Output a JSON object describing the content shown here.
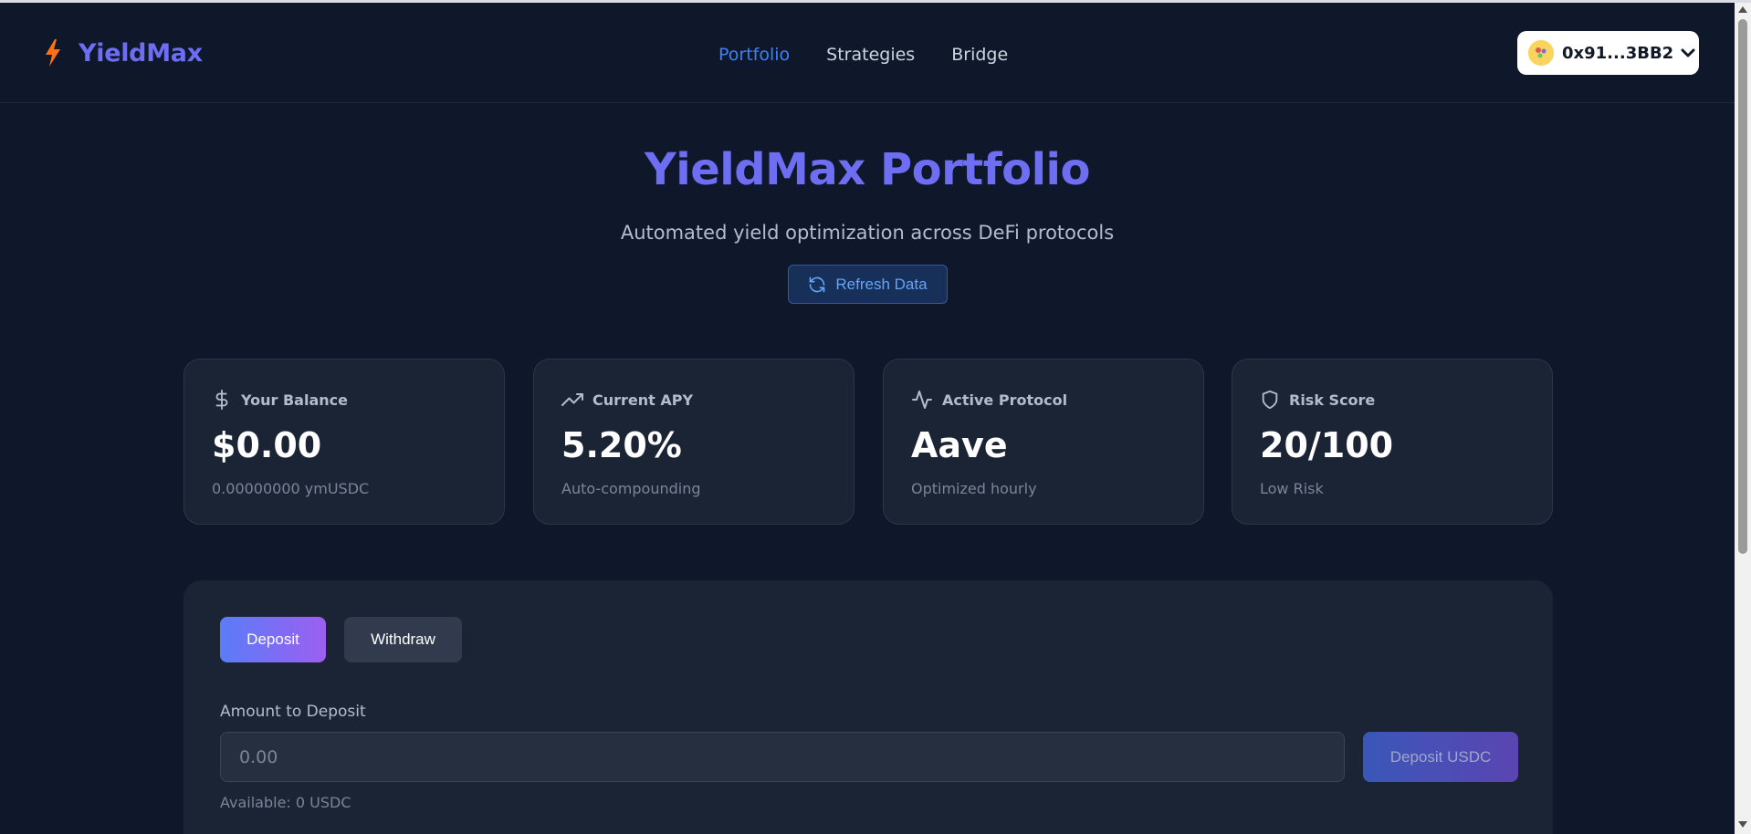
{
  "app": {
    "name": "YieldMax",
    "logo_icon": "lightning-bolt-icon",
    "accent_color": "#6d6ef2"
  },
  "nav": {
    "items": [
      {
        "label": "Portfolio",
        "active": true
      },
      {
        "label": "Strategies",
        "active": false
      },
      {
        "label": "Bridge",
        "active": false
      }
    ]
  },
  "wallet": {
    "address": "0x91...3BB2",
    "avatar_icon": "wallet-avatar-icon",
    "chevron_icon": "chevron-down-icon"
  },
  "hero": {
    "title": "YieldMax Portfolio",
    "subtitle": "Automated yield optimization across DeFi protocols",
    "refresh_label": "Refresh Data",
    "refresh_icon": "refresh-icon"
  },
  "stats": [
    {
      "icon": "dollar-icon",
      "label": "Your Balance",
      "value": "$0.00",
      "sub": "0.00000000 ymUSDC"
    },
    {
      "icon": "trending-up-icon",
      "label": "Current APY",
      "value": "5.20%",
      "sub": "Auto-compounding"
    },
    {
      "icon": "activity-icon",
      "label": "Active Protocol",
      "value": "Aave",
      "sub": "Optimized hourly"
    },
    {
      "icon": "shield-icon",
      "label": "Risk Score",
      "value": "20/100",
      "sub": "Low Risk"
    }
  ],
  "action_panel": {
    "tabs": [
      {
        "label": "Deposit",
        "active": true
      },
      {
        "label": "Withdraw",
        "active": false
      }
    ],
    "amount_label": "Amount to Deposit",
    "amount_placeholder": "0.00",
    "amount_value": "",
    "submit_label": "Deposit USDC",
    "available": "Available: 0 USDC"
  }
}
